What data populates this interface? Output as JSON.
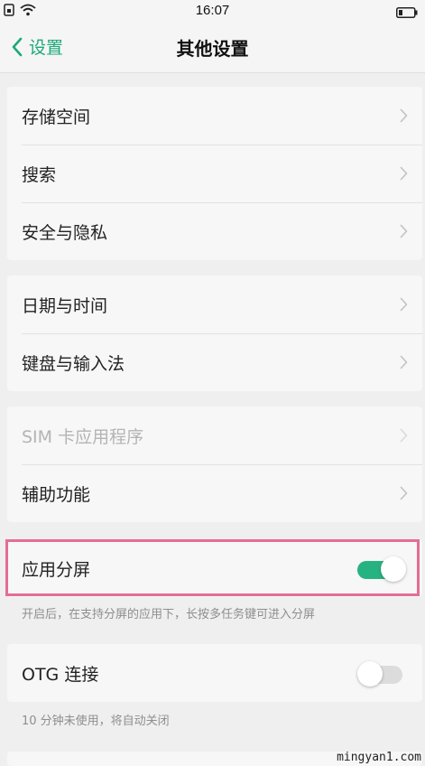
{
  "status_bar": {
    "time": "16:07",
    "icons": [
      "sim-card-icon",
      "wifi-icon",
      "battery-icon"
    ]
  },
  "nav": {
    "back_label": "设置",
    "title": "其他设置"
  },
  "groups": [
    {
      "items": [
        {
          "label": "存储空间",
          "enabled": true
        },
        {
          "label": "搜索",
          "enabled": true
        },
        {
          "label": "安全与隐私",
          "enabled": true
        }
      ]
    },
    {
      "items": [
        {
          "label": "日期与时间",
          "enabled": true
        },
        {
          "label": "键盘与输入法",
          "enabled": true
        }
      ]
    },
    {
      "items": [
        {
          "label": "SIM 卡应用程序",
          "enabled": false
        },
        {
          "label": "辅助功能",
          "enabled": true
        }
      ]
    }
  ],
  "split_screen": {
    "label": "应用分屏",
    "on": true,
    "hint": "开启后，在支持分屏的应用下，长按多任务键可进入分屏"
  },
  "otg": {
    "label": "OTG 连接",
    "on": false,
    "hint": "10 分钟未使用，将自动关闭"
  },
  "colors": {
    "accent": "#1ca879",
    "toggle_on": "#27b381",
    "highlight": "#e56d93"
  },
  "watermark": "mingyan1.com"
}
